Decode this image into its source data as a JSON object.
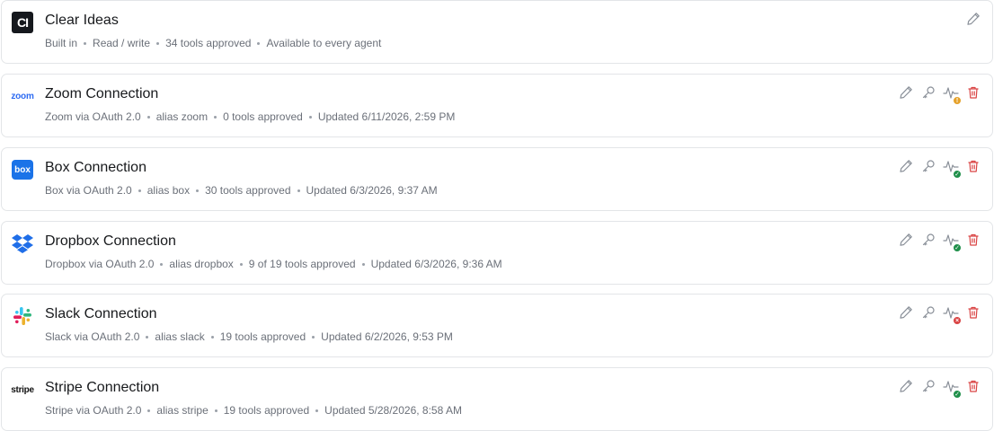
{
  "connections": [
    {
      "name": "Clear Ideas",
      "logo": "clear-ideas-logo",
      "logo_text": "CI",
      "meta": [
        "Built in",
        "Read / write",
        "34 tools approved",
        "Available to every agent"
      ],
      "actions": [
        "edit"
      ],
      "health_status": null
    },
    {
      "name": "Zoom Connection",
      "logo": "zoom-logo",
      "logo_text": "zoom",
      "meta": [
        "Zoom via OAuth 2.0",
        "alias zoom",
        "0 tools approved",
        "Updated 6/11/2026, 2:59 PM"
      ],
      "actions": [
        "edit",
        "key",
        "health",
        "delete"
      ],
      "health_status": "warning"
    },
    {
      "name": "Box Connection",
      "logo": "box-logo",
      "logo_text": "box",
      "meta": [
        "Box via OAuth 2.0",
        "alias box",
        "30 tools approved",
        "Updated 6/3/2026, 9:37 AM"
      ],
      "actions": [
        "edit",
        "key",
        "health",
        "delete"
      ],
      "health_status": "ok"
    },
    {
      "name": "Dropbox Connection",
      "logo": "dropbox-logo",
      "logo_text": "",
      "meta": [
        "Dropbox via OAuth 2.0",
        "alias dropbox",
        "9 of 19 tools approved",
        "Updated 6/3/2026, 9:36 AM"
      ],
      "actions": [
        "edit",
        "key",
        "health",
        "delete"
      ],
      "health_status": "ok"
    },
    {
      "name": "Slack Connection",
      "logo": "slack-logo",
      "logo_text": "",
      "meta": [
        "Slack via OAuth 2.0",
        "alias slack",
        "19 tools approved",
        "Updated 6/2/2026, 9:53 PM"
      ],
      "actions": [
        "edit",
        "key",
        "health",
        "delete"
      ],
      "health_status": "error"
    },
    {
      "name": "Stripe Connection",
      "logo": "stripe-logo",
      "logo_text": "stripe",
      "meta": [
        "Stripe via OAuth 2.0",
        "alias stripe",
        "19 tools approved",
        "Updated 5/28/2026, 8:58 AM"
      ],
      "actions": [
        "edit",
        "key",
        "health",
        "delete"
      ],
      "health_status": "ok"
    }
  ],
  "colors": {
    "delete": "#d94343",
    "health_ok": "#1f8f4a",
    "health_warning": "#e5a12a",
    "health_error": "#d94343",
    "icon_gray": "#8a9099"
  }
}
